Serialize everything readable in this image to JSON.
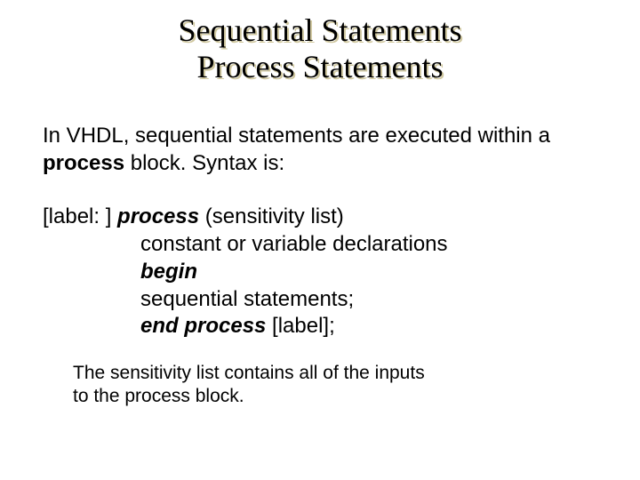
{
  "title": {
    "line1": "Sequential Statements",
    "line2": "Process Statements"
  },
  "para1": {
    "pre": "In VHDL, sequential statements are executed within a ",
    "bold": "process",
    "post": " block.  Syntax is:"
  },
  "syntax": {
    "l1_pre": "[label: ] ",
    "l1_bold": "process",
    "l1_post": " (sensitivity list)",
    "l2": " constant or variable declarations",
    "l3_bold": "begin",
    "l4": " sequential statements;",
    "l5_bold": "end process",
    "l5_post": " [label];"
  },
  "note": {
    "l1": "The sensitivity list contains all of the inputs",
    "l2": "to the process block."
  }
}
